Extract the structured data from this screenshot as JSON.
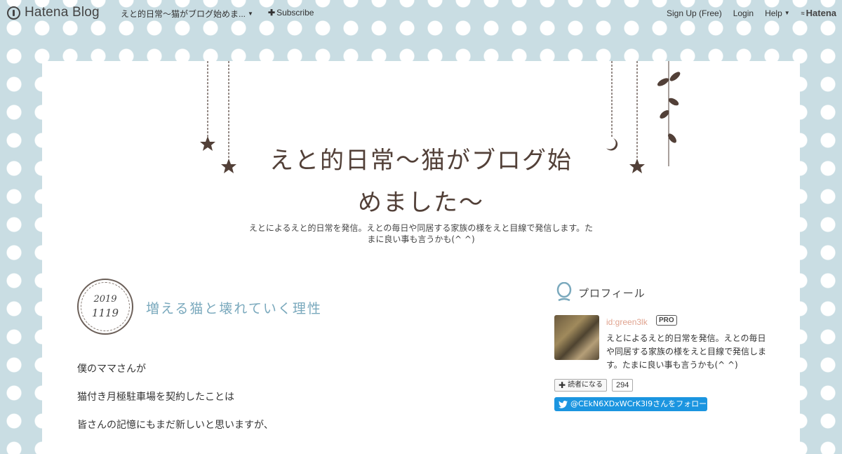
{
  "topbar": {
    "logo_text": "Hatena Blog",
    "blog_title": "えと的日常〜猫がブログ始めま...",
    "subscribe": "Subscribe",
    "signup": "Sign Up (Free)",
    "login": "Login",
    "help": "Help",
    "brand": "Hatena"
  },
  "header": {
    "title_line1": "えと的日常〜猫がブログ始",
    "title_line2": "めました〜",
    "description": "えとによるえと的日常を発信。えとの毎日や同居する家族の様をえと目線で発信します。たまに良い事も言うかも(^ ^)"
  },
  "entry": {
    "date_year": "2019",
    "date_md": "1119",
    "title": "増える猫と壊れていく理性",
    "paragraphs": [
      "僕のママさんが",
      "猫付き月極駐車場を契約したことは",
      "皆さんの記憶にもまだ新しいと思いますが、"
    ]
  },
  "sidebar": {
    "profile_label": "プロフィール",
    "user_id": "id:green3lk",
    "pro": "PRO",
    "profile_desc": "えとによるえと的日常を発信。えとの毎日や同居する家族の様をえと目線で発信します。たまに良い事も言うかも(^ ^)",
    "reader_button": "読者になる",
    "reader_count": "294",
    "twitter_follow": "@CEkN6XDxWCrK3l9さんをフォロー"
  },
  "colors": {
    "background": "#c9dde3",
    "title_brown": "#524038",
    "entry_title_blue": "#7aa9bd",
    "user_id_pink": "#e0a38f",
    "twitter_blue": "#1b95e0"
  }
}
